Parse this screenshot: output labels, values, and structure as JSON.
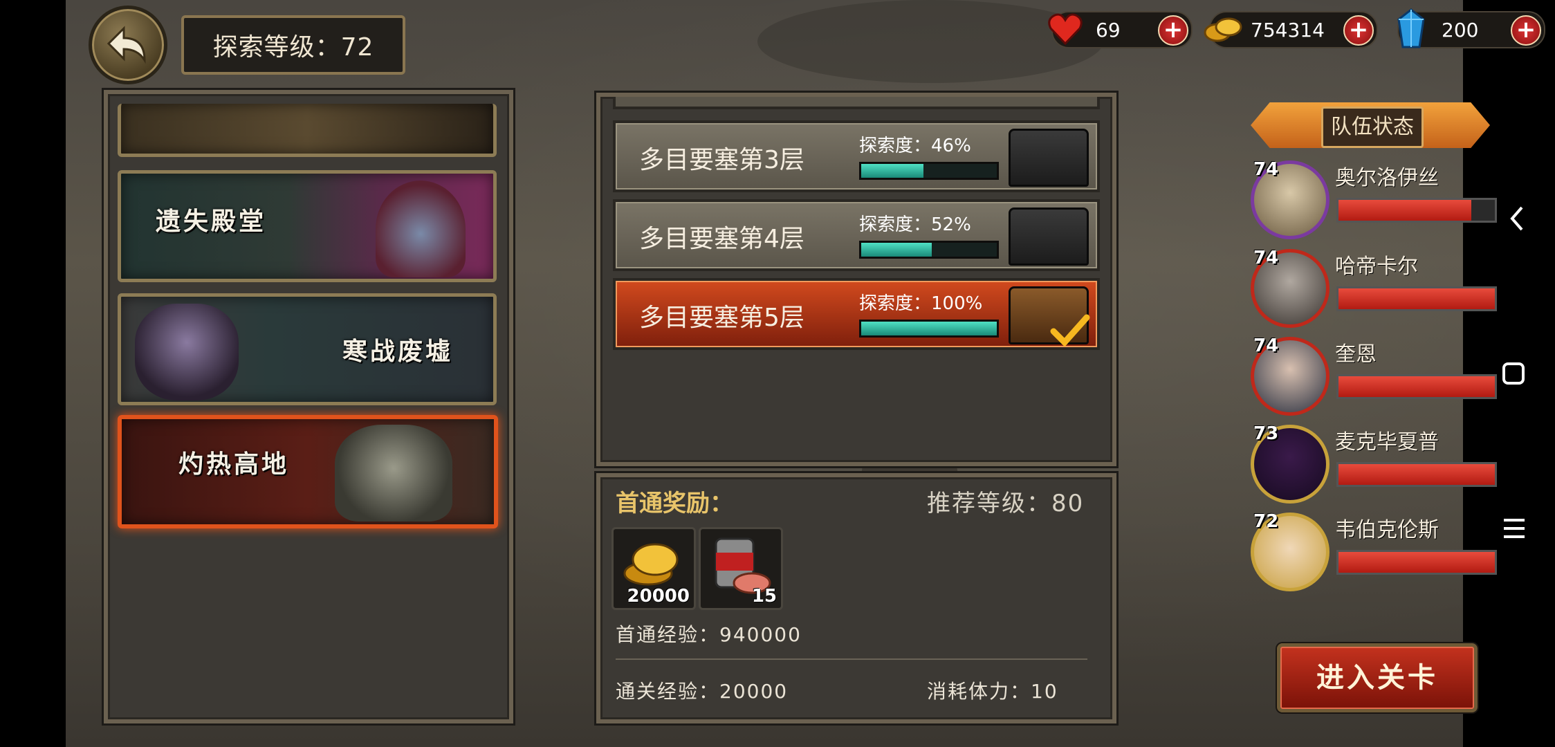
{
  "header": {
    "explore_level": "探索等级：72"
  },
  "resources": {
    "hearts": "69",
    "gold": "754314",
    "crystal": "200"
  },
  "zones": [
    {
      "label": "遗失殿堂"
    },
    {
      "label": "寒战废墟"
    },
    {
      "label": "灼热高地"
    }
  ],
  "floors": [
    {
      "name": "多目要塞第3层",
      "explore_label": "探索度：46%",
      "progress": 0.46
    },
    {
      "name": "多目要塞第4层",
      "explore_label": "探索度：52%",
      "progress": 0.52
    },
    {
      "name": "多目要塞第5层",
      "explore_label": "探索度：100%",
      "progress": 1.0
    }
  ],
  "reward": {
    "title": "首通奖励：",
    "recommended": "推荐等级：80",
    "items": [
      {
        "icon": "gold-coins-icon",
        "count": "20000"
      },
      {
        "icon": "meat-can-icon",
        "count": "15"
      }
    ],
    "first_exp": "首通经验：940000",
    "clear_exp": "通关经验：20000",
    "stamina": "消耗体力：10"
  },
  "team": {
    "title": "队伍状态",
    "heroes": [
      {
        "level": "74",
        "name": "奥尔洛伊丝",
        "hp": 0.85,
        "ring": "#7b3aa0"
      },
      {
        "level": "74",
        "name": "哈帝卡尔",
        "hp": 1.0,
        "ring": "#c0281a"
      },
      {
        "level": "74",
        "name": "奎恩",
        "hp": 1.0,
        "ring": "#c0281a"
      },
      {
        "level": "73",
        "name": "麦克毕夏普",
        "hp": 1.0,
        "ring": "#c8a23a"
      },
      {
        "level": "72",
        "name": "韦伯克伦斯",
        "hp": 1.0,
        "ring": "#c8a23a"
      }
    ]
  },
  "enter_button": "进入关卡",
  "colors": {
    "accent": "#e0531c",
    "progress": "#2fbfa4",
    "hp": "#d8301f",
    "gold": "#e8c46a"
  }
}
